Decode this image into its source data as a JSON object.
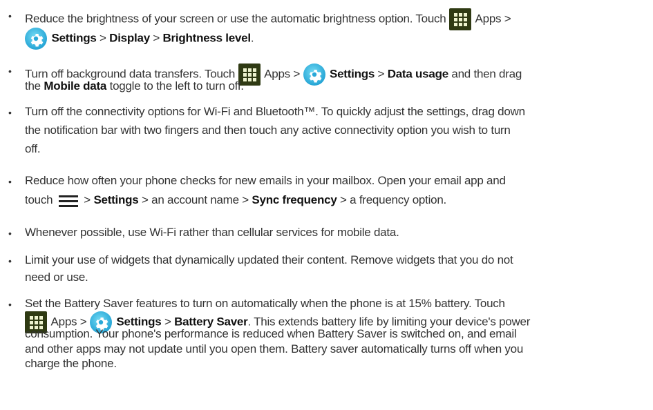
{
  "tips": [
    {
      "lines": [
        [
          {
            "t": "Reduce the brightness of your screen or use the automatic brightness option. Touch "
          },
          {
            "icon": "apps"
          },
          {
            "t": " Apps >"
          }
        ],
        [
          {
            "icon": "settings"
          },
          {
            "t": " "
          },
          {
            "t": "Settings",
            "b": true
          },
          {
            "t": " > "
          },
          {
            "t": "Display",
            "b": true
          },
          {
            "t": " > "
          },
          {
            "t": "Brightness level",
            "b": true
          },
          {
            "t": "."
          }
        ]
      ]
    },
    {
      "lines": [
        [
          {
            "t": "Turn off background data transfers. Touch "
          },
          {
            "icon": "apps"
          },
          {
            "t": " Apps > "
          },
          {
            "icon": "settings"
          },
          {
            "t": " "
          },
          {
            "t": "Settings",
            "b": true
          },
          {
            "t": " > "
          },
          {
            "t": "Data usage",
            "b": true
          },
          {
            "t": " and then drag"
          }
        ],
        [
          {
            "t": "the "
          },
          {
            "t": "Mobile data",
            "b": true
          },
          {
            "t": " toggle to the left to turn off."
          }
        ]
      ]
    },
    {
      "lines": [
        [
          {
            "t": "Turn off the connectivity options for Wi-Fi and Bluetooth™. To quickly adjust the settings, drag down"
          }
        ],
        [
          {
            "t": "the notification bar with two fingers and then touch any active connectivity option you wish to turn"
          }
        ],
        [
          {
            "t": "off."
          }
        ]
      ]
    },
    {
      "lines": [
        [
          {
            "t": "Reduce how often your phone checks for new emails in your mailbox. Open your email app and"
          }
        ],
        [
          {
            "t": "touch "
          },
          {
            "icon": "menu"
          },
          {
            "t": " > "
          },
          {
            "t": "Settings",
            "b": true
          },
          {
            "t": " > an account name > "
          },
          {
            "t": "Sync frequency",
            "b": true
          },
          {
            "t": " > a frequency option."
          }
        ]
      ]
    },
    {
      "lines": [
        [
          {
            "t": "Whenever possible, use Wi-Fi rather than cellular services for mobile data."
          }
        ]
      ]
    },
    {
      "lines": [
        [
          {
            "t": "Limit your use of widgets that dynamically updated their content. Remove widgets that you do not"
          }
        ],
        [
          {
            "t": "need or use."
          }
        ]
      ]
    },
    {
      "lines": [
        [
          {
            "t": "Set the Battery Saver features to turn on automatically when the phone is at 15% battery. Touch"
          }
        ],
        [
          {
            "icon": "apps"
          },
          {
            "t": " Apps > "
          },
          {
            "icon": "settings"
          },
          {
            "t": " "
          },
          {
            "t": "Settings",
            "b": true
          },
          {
            "t": " > "
          },
          {
            "t": "Battery Saver",
            "b": true
          },
          {
            "t": ". This extends battery life by limiting your device's power"
          }
        ],
        [
          {
            "t": "consumption. Your phone's performance is reduced when Battery Saver is switched on, and email"
          }
        ],
        [
          {
            "t": "and other apps may not update until you open them. Battery saver automatically turns off when you"
          }
        ],
        [
          {
            "t": "charge the phone."
          }
        ]
      ]
    }
  ],
  "bullet": "•"
}
